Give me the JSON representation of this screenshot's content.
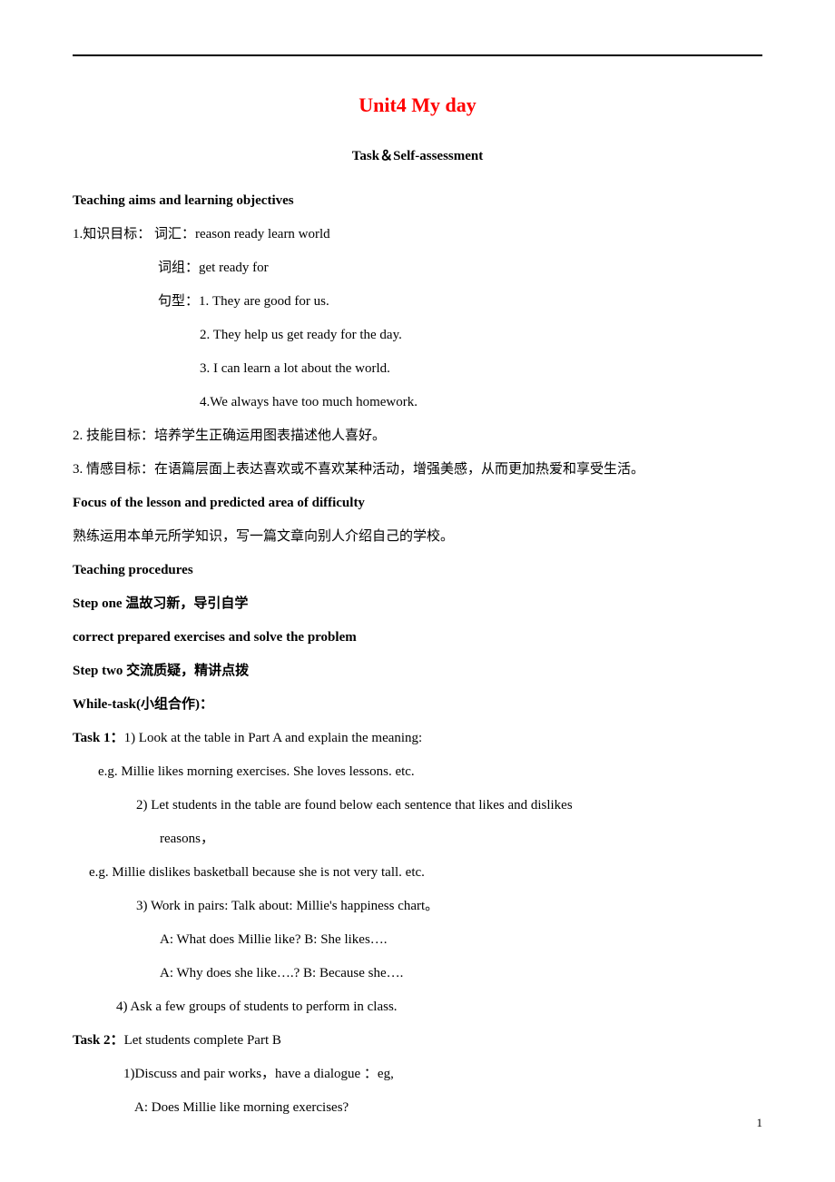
{
  "title": "Unit4 My day",
  "subtitle": "Task＆Self-assessment",
  "aims_heading": "Teaching aims and learning objectives",
  "aim1_label": "1.知识目标：  词汇：reason   ready   learn  world",
  "aim1_phrase": "词组：get ready for",
  "aim1_sentence_label": "句型：1. They are good for us.",
  "aim1_sentence2": "2. They help us get ready for the day.",
  "aim1_sentence3": "3. I can learn a lot about the world.",
  "aim1_sentence4": "4.We always have too much homework.",
  "aim2": "2. 技能目标：培养学生正确运用图表描述他人喜好。",
  "aim3": "3. 情感目标：在语篇层面上表达喜欢或不喜欢某种活动，增强美感，从而更加热爱和享受生活。",
  "focus_heading": "Focus of the lesson and predicted area of difficulty",
  "focus_body": "熟练运用本单元所学知识，写一篇文章向别人介绍自己的学校。",
  "procedures_heading": "Teaching procedures",
  "step1_heading": "Step one 温故习新，导引自学",
  "step1_body": "correct prepared exercises and solve the problem",
  "step2_heading": "Step two 交流质疑，精讲点拨",
  "while_task": "While-task(小组合作)：",
  "task1_label": "Task 1：",
  "task1_1": "1) Look at the table in Part A and explain the meaning:",
  "task1_eg1": "e.g.   Millie likes morning exercises. She loves lessons. etc.",
  "task1_2": "2) Let students in the table are found below each sentence that likes and dislikes",
  "task1_2b": "reasons，",
  "task1_eg2": "e.g.   Millie dislikes basketball because she is not very tall. etc.",
  "task1_3": "3) Work in pairs: Talk about: Millie's happiness chart。",
  "task1_3a": "A: What does Millie like?    B: She likes….",
  "task1_3b": "A: Why does she like….?    B: Because she….",
  "task1_4": "4) Ask a few groups of students to perform in class.",
  "task2_label": "Task 2：",
  "task2_body": "Let students complete Part B",
  "task2_1": "1)Discuss and pair works，have a dialogue ：eg,",
  "task2_1a": "A: Does Millie like morning exercises?",
  "page_num": "1"
}
